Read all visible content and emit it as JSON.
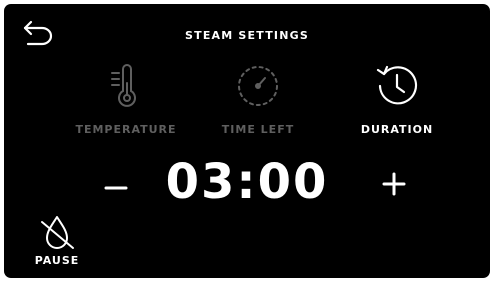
{
  "header": {
    "title": "STEAM SETTINGS",
    "back_icon": "back-arrow-icon"
  },
  "tabs": [
    {
      "label": "TEMPERATURE",
      "icon": "thermometer-icon",
      "state": "inactive"
    },
    {
      "label": "TIME LEFT",
      "icon": "timer-dial-icon",
      "state": "inactive"
    },
    {
      "label": "DURATION",
      "icon": "clock-refresh-icon",
      "state": "active"
    }
  ],
  "setting": {
    "value": "03:00",
    "decrease_label": "−",
    "increase_label": "+"
  },
  "footer": {
    "pause_label": "PAUSE",
    "pause_icon": "no-steam-drop-icon"
  },
  "colors": {
    "background": "#000000",
    "text": "#ffffff",
    "inactive": "#5f5f5f"
  }
}
